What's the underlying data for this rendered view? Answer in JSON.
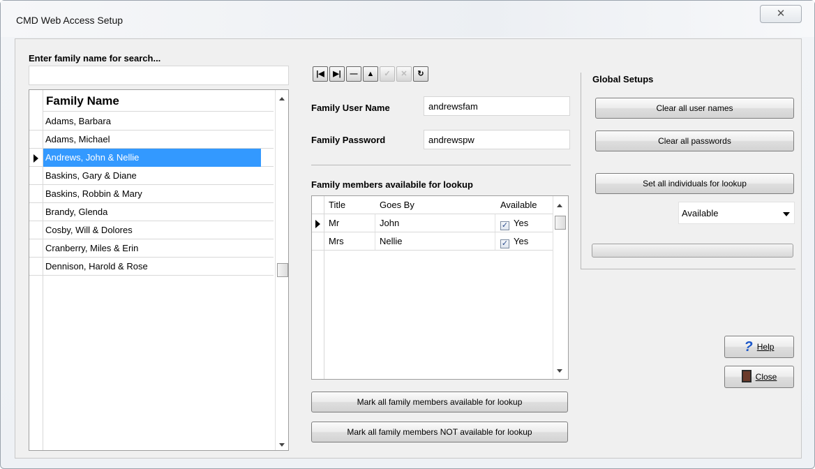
{
  "window": {
    "title": "CMD Web Access Setup",
    "close_glyph": "✕"
  },
  "search": {
    "label": "Enter family name for search...",
    "value": "",
    "placeholder": ""
  },
  "family_grid": {
    "header": "Family Name",
    "rows": [
      "Adams, Barbara",
      "Adams, Michael",
      "Andrews, John & Nellie",
      "Baskins, Gary & Diane",
      "Baskins, Robbin & Mary",
      "Brandy, Glenda",
      "Cosby, Will & Dolores",
      "Cranberry, Miles & Erin",
      "Dennison, Harold & Rose"
    ],
    "selected_index": 2
  },
  "navigator": {
    "buttons": [
      {
        "name": "first-record",
        "glyph": "|◀"
      },
      {
        "name": "last-record",
        "glyph": "▶|"
      },
      {
        "name": "delete-record",
        "glyph": "—"
      },
      {
        "name": "edit-record",
        "glyph": "▲"
      },
      {
        "name": "post-record",
        "glyph": "✓"
      },
      {
        "name": "cancel-record",
        "glyph": "✕"
      },
      {
        "name": "refresh-records",
        "glyph": "↻"
      }
    ]
  },
  "credentials": {
    "user_label": "Family User Name",
    "user_value": "andrewsfam",
    "password_label": "Family Password",
    "password_value": "andrewspw"
  },
  "members": {
    "label": "Family members availabile for lookup",
    "columns": [
      "Title",
      "Goes By",
      "Available"
    ],
    "rows": [
      {
        "title": "Mr",
        "goes_by": "John",
        "available": "Yes"
      },
      {
        "title": "Mrs",
        "goes_by": "Nellie",
        "available": "Yes"
      }
    ],
    "mark_all_button": "Mark all family members available for lookup",
    "mark_none_button": "Mark all family members NOT available for lookup"
  },
  "global": {
    "label": "Global Setups",
    "clear_users": "Clear all user names",
    "clear_passwords": "Clear all passwords",
    "set_all": "Set all individuals for lookup",
    "dropdown_value": "Available",
    "progress_percent": 0
  },
  "footer": {
    "help": "Help",
    "close": "Close"
  },
  "colors": {
    "selection": "#3399ff",
    "help_icon": "#1a56c8"
  }
}
